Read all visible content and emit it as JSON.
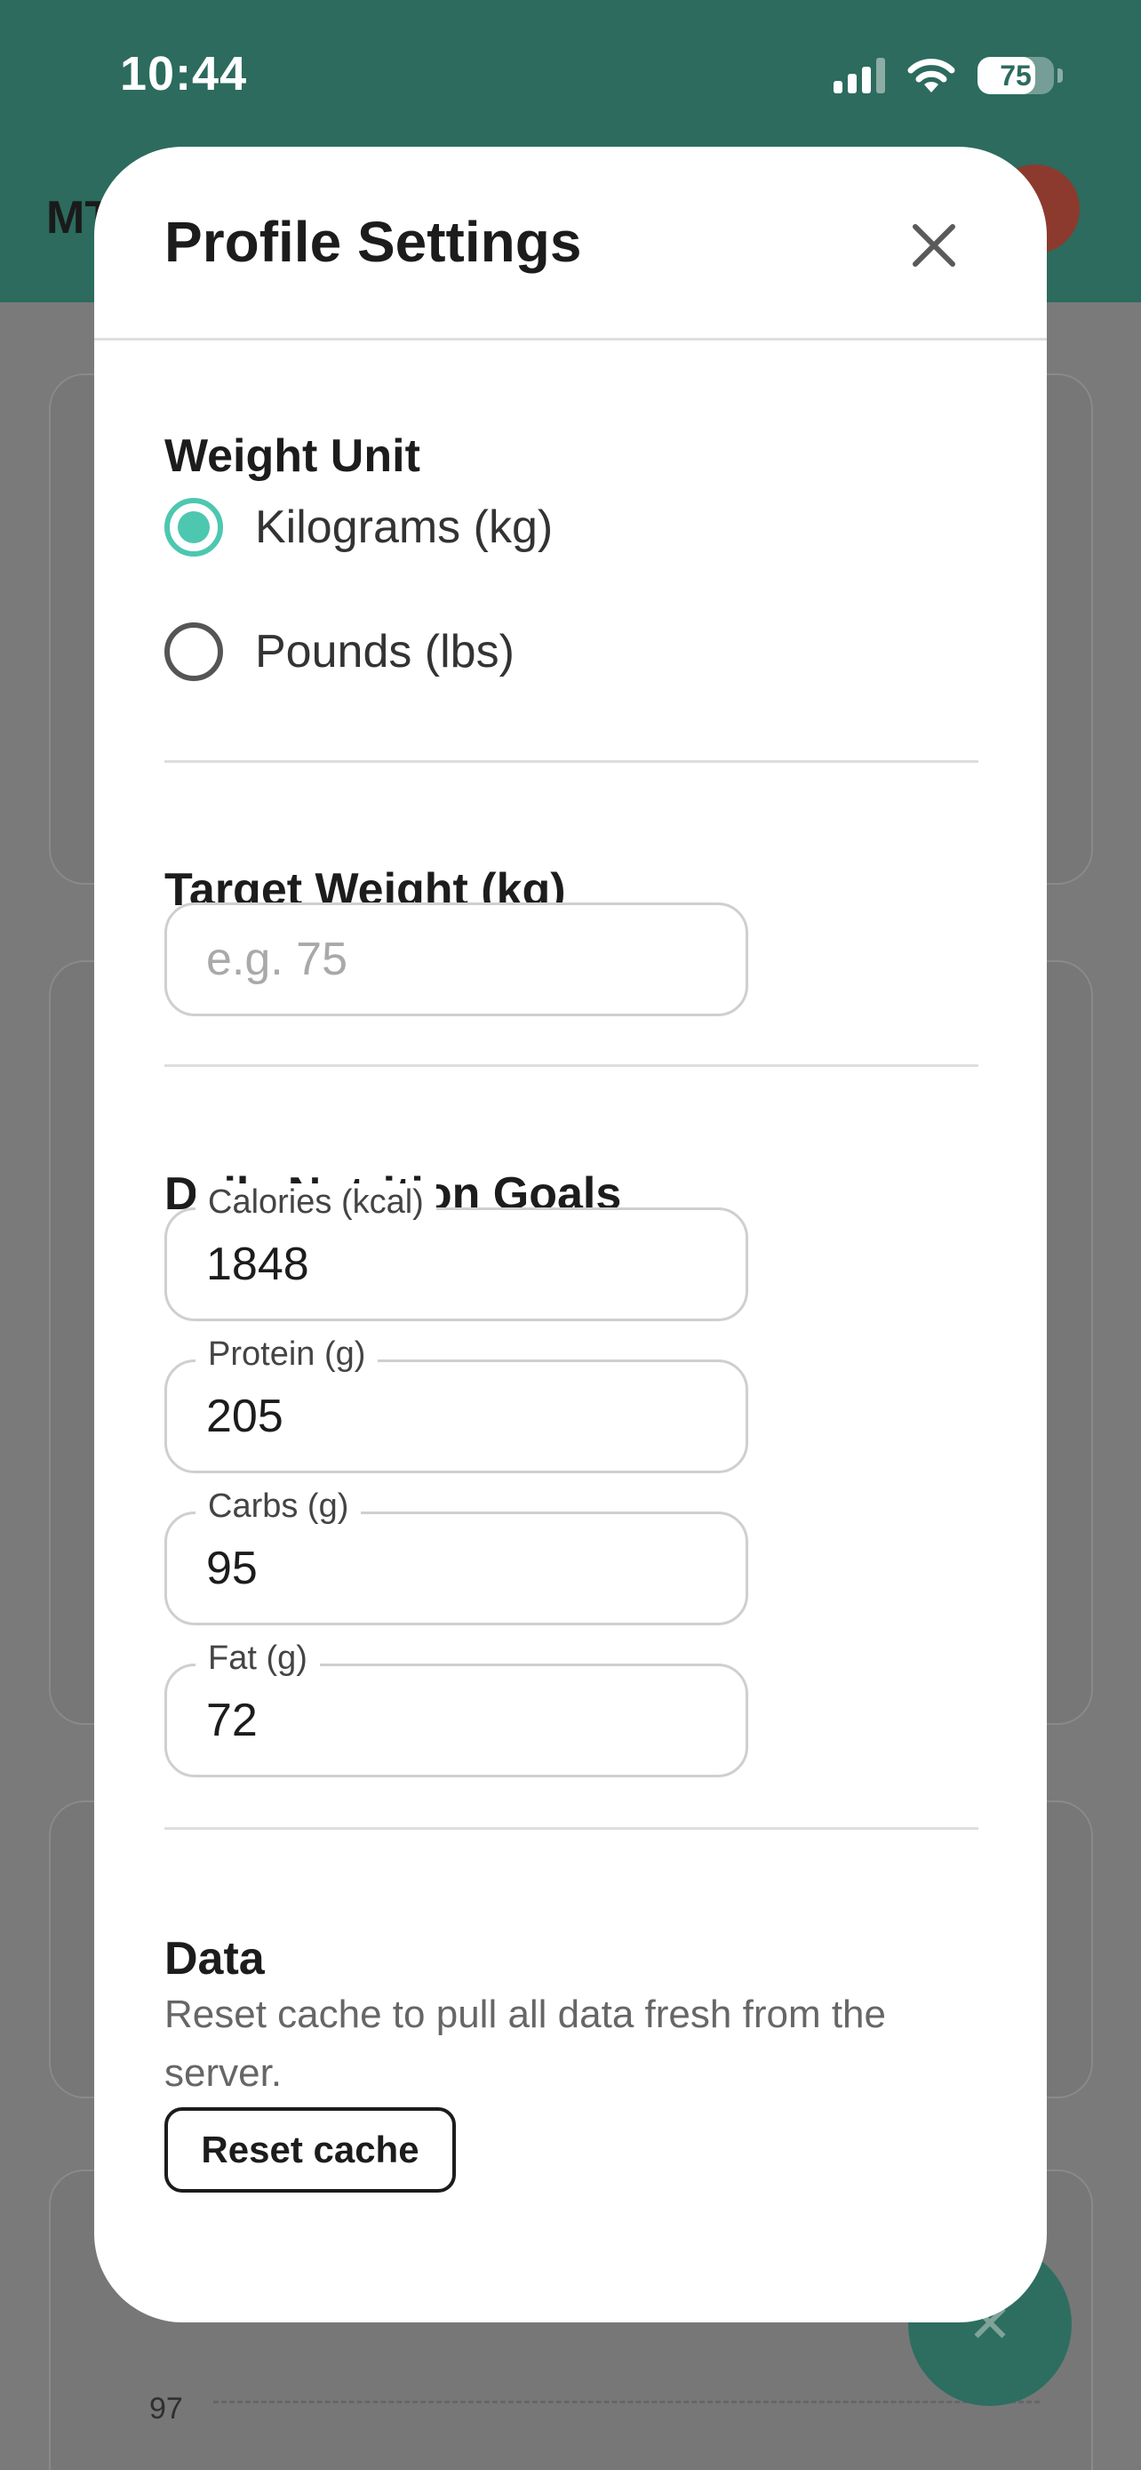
{
  "status_bar": {
    "time": "10:44",
    "battery_percent": "75",
    "battery_level": 0.75
  },
  "app_header": {
    "title_fragment": "MT"
  },
  "background": {
    "chart_tick": "97"
  },
  "modal": {
    "title": "Profile Settings",
    "close_icon": "close-icon",
    "weight_unit": {
      "title": "Weight Unit",
      "options": [
        {
          "label": "Kilograms (kg)",
          "selected": true
        },
        {
          "label": "Pounds (lbs)",
          "selected": false
        }
      ]
    },
    "target_weight": {
      "title": "Target Weight (kg)",
      "placeholder": "e.g. 75",
      "value": ""
    },
    "nutrition": {
      "title": "Daily Nutrition Goals",
      "fields": [
        {
          "label": "Calories (kcal)",
          "value": "1848"
        },
        {
          "label": "Protein (g)",
          "value": "205"
        },
        {
          "label": "Carbs (g)",
          "value": "95"
        },
        {
          "label": "Fat (g)",
          "value": "72"
        }
      ]
    },
    "data": {
      "title": "Data",
      "description": "Reset cache to pull all data fresh from the server.",
      "reset_label": "Reset cache"
    }
  },
  "colors": {
    "accent": "#4dc7b0",
    "header": "#2c6b5e",
    "overlay": "#7a7a7a"
  }
}
